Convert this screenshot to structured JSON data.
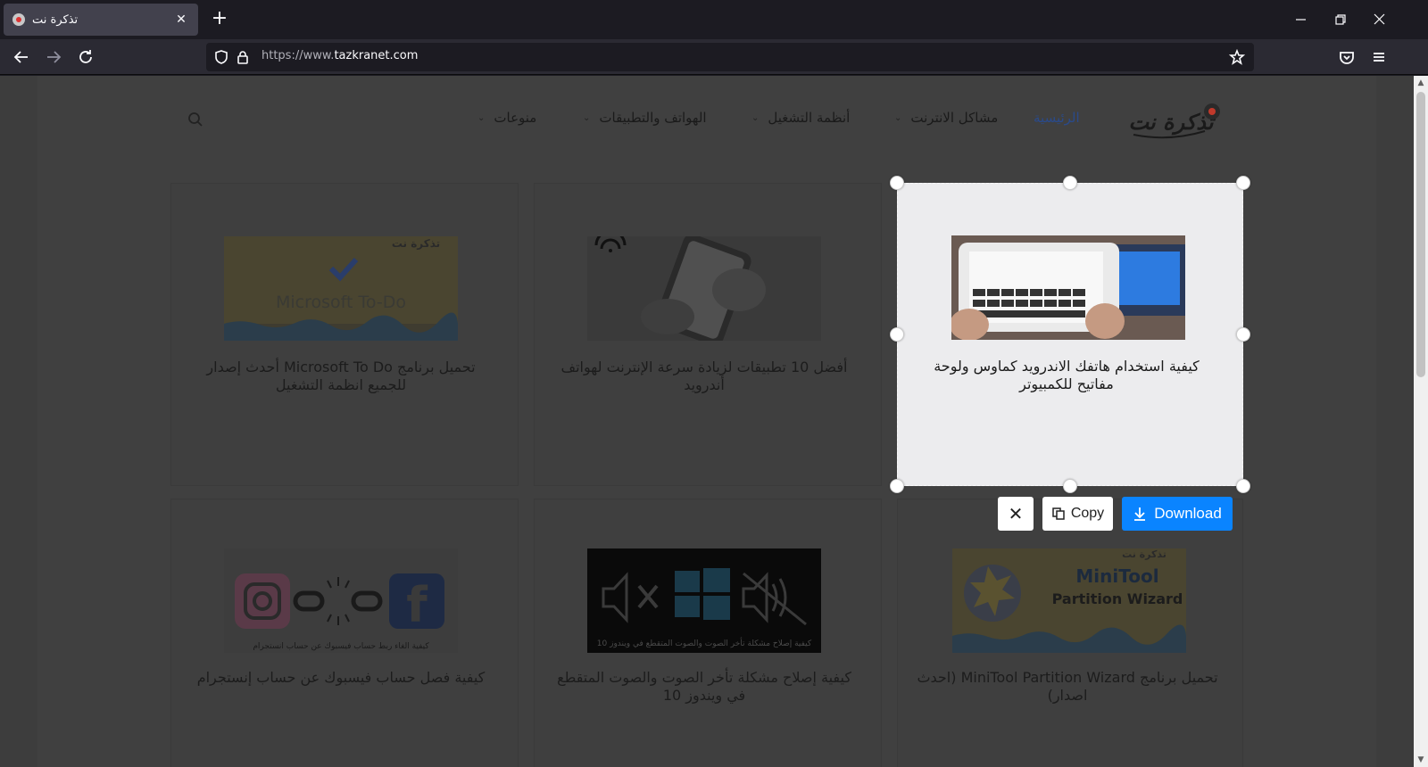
{
  "browser": {
    "tab_title": "تذكرة نت",
    "url_prefix": "https://www.",
    "url_domain": "tazkranet.com"
  },
  "site": {
    "nav": [
      {
        "label": "الرئيسية",
        "active": true
      },
      {
        "label": "مشاكل الانترنت",
        "has_dropdown": true
      },
      {
        "label": "أنظمة التشغيل",
        "has_dropdown": true
      },
      {
        "label": "الهواتف والتطبيقات",
        "has_dropdown": true
      },
      {
        "label": "منوعات",
        "has_dropdown": true
      }
    ],
    "logo_text": "تذكرة نت"
  },
  "cards": [
    {
      "title": "كيفية استخدام هاتفك الاندرويد كماوس ولوحة مفاتيح للكمبيوتر",
      "selected": true
    },
    {
      "title": "أفضل 10 تطبيقات لزيادة سرعة الإنترنت لهواتف أندرويد"
    },
    {
      "title": "تحميل برنامج Microsoft To Do أحدث إصدار للجميع انظمة التشغيل",
      "thumb_text": "Microsoft To-Do",
      "thumb_logo": "تذكرة نت"
    },
    {
      "title": "تحميل برنامج MiniTool Partition Wizard (احدث اصدار)",
      "thumb_text1": "MiniTool",
      "thumb_text2": "Partition Wizard",
      "thumb_logo": "تذكرة نت"
    },
    {
      "title": "كيفية إصلاح مشكلة تأخر الصوت والصوت المتقطع في ويندوز 10",
      "thumb_caption": "كيفية إصلاح مشكلة تأخر الصوت والصوت المتقطع في ويندوز 10"
    },
    {
      "title": "كيفية فصل حساب فيسبوك عن حساب إنستجرام",
      "thumb_caption": "كيفية الغاء ربط حساب فيسبوك عن حساب انستجرام"
    }
  ],
  "screenshot_tool": {
    "close_label": "✕",
    "copy_label": "Copy",
    "download_label": "Download",
    "accent": "#0a84ff"
  }
}
